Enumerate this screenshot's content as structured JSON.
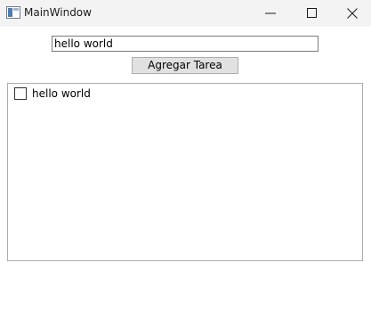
{
  "window": {
    "title": "MainWindow",
    "icon": "window-app-icon",
    "controls": {
      "minimize_icon": "minimize-icon",
      "maximize_icon": "maximize-icon",
      "close_icon": "close-icon"
    }
  },
  "task_input": {
    "value": "hello world"
  },
  "add_button": {
    "label": "Agregar Tarea"
  },
  "task_list": {
    "items": [
      {
        "label": "hello world",
        "checked": false
      }
    ]
  }
}
